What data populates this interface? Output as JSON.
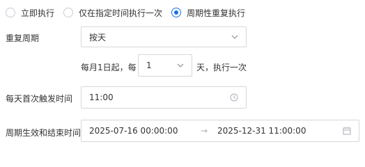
{
  "schedule_mode": {
    "options": [
      {
        "label": "立即执行",
        "checked": false
      },
      {
        "label": "仅在指定时间执行一次",
        "checked": false
      },
      {
        "label": "周期性重复执行",
        "checked": true
      }
    ]
  },
  "repeat_period": {
    "label": "重复周期",
    "value": "按天",
    "icon": "chevron-down-icon"
  },
  "interval": {
    "prefix": "每月1日起，每",
    "value": "1",
    "suffix": "天，执行一次",
    "icon": "chevron-down-icon"
  },
  "first_trigger": {
    "label": "每天首次触发时间",
    "value": "11:00",
    "icon": "clock-icon"
  },
  "period_range": {
    "label": "周期生效和结束时间",
    "start": "2025-07-16 00:00:00",
    "separator": "→",
    "end": "2025-12-31 11:00:00",
    "icon": "calendar-icon"
  },
  "colors": {
    "accent": "#1b72e8",
    "border": "#d4d7de",
    "text": "#333333",
    "icon": "#a8adb6"
  }
}
